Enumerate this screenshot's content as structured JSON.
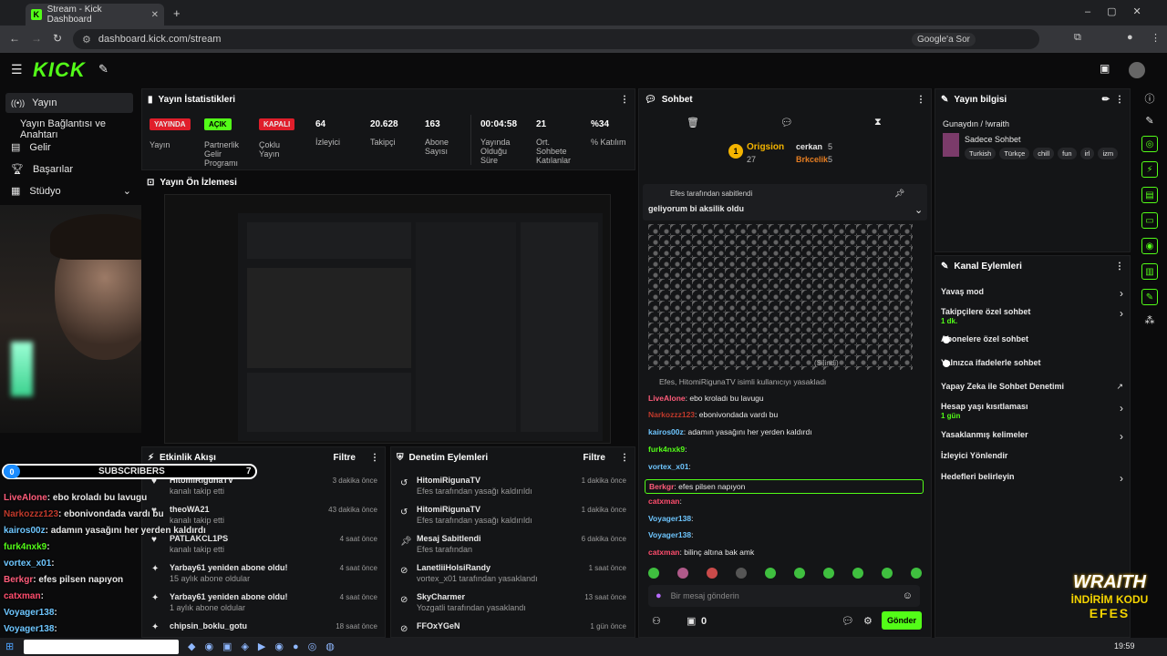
{
  "browser": {
    "tab_title": "Stream - Kick Dashboard",
    "url": "dashboard.kick.com/stream",
    "google_label": "Google'a Sor"
  },
  "nav": {
    "logo": "KICK",
    "items": [
      {
        "label": "Yayın"
      },
      {
        "label": "Yayın Bağlantısı ve Anahtarı"
      },
      {
        "label": "Gelir"
      },
      {
        "label": "Başarılar"
      },
      {
        "label": "Stüdyo"
      }
    ]
  },
  "stats": {
    "title": "Yayın İstatistikleri",
    "status_badges": [
      {
        "label": "YAYINDA",
        "sub": "Yayın"
      },
      {
        "label": "AÇIK",
        "sub": "Partnerlik Gelir Programı"
      },
      {
        "label": "KAPALI",
        "sub": "Çoklu Yayın"
      }
    ],
    "items": [
      {
        "value": "64",
        "label": "İzleyici"
      },
      {
        "value": "20.628",
        "label": "Takipçi"
      },
      {
        "value": "163",
        "label": "Abone Sayısı"
      },
      {
        "value": "00:04:58",
        "label": "Yayında Olduğu Süre"
      },
      {
        "value": "21",
        "label": "Ort. Sohbete Katılanlar"
      },
      {
        "value": "%34",
        "label": "% Katılım"
      }
    ]
  },
  "preview": {
    "title": "Yayın Ön İzlemesi"
  },
  "activity": {
    "title": "Etkinlik Akışı",
    "filter": "Filtre",
    "items": [
      {
        "name": "HitomiRigunaTV",
        "desc": "kanalı takip etti",
        "time": "3 dakika önce"
      },
      {
        "name": "theoWA21",
        "desc": "kanalı takip etti",
        "time": "43 dakika önce"
      },
      {
        "name": "PATLAKCL1PS",
        "desc": "kanalı takip etti",
        "time": "4 saat önce"
      },
      {
        "name": "Yarbay61 yeniden abone oldu!",
        "desc": "15 aylık abone oldular",
        "time": "4 saat önce"
      },
      {
        "name": "Yarbay61 yeniden abone oldu!",
        "desc": "1 aylık abone oldular",
        "time": "4 saat önce"
      },
      {
        "name": "chipsin_boklu_gotu",
        "desc": "",
        "time": "18 saat önce"
      }
    ]
  },
  "moderation": {
    "title": "Denetim Eylemleri",
    "filter": "Filtre",
    "items": [
      {
        "name": "HitomiRigunaTV",
        "desc": "Efes tarafından yasağı kaldırıldı",
        "time": "1 dakika önce"
      },
      {
        "name": "HitomiRigunaTV",
        "desc": "Efes tarafından yasağı kaldırıldı",
        "time": "1 dakika önce"
      },
      {
        "name": "Mesaj Sabitlendi",
        "desc": "Efes tarafından",
        "time": "6 dakika önce"
      },
      {
        "name": "LanetliiHolsiRandy",
        "desc": "vortex_x01 tarafından yasaklandı",
        "time": "1 saat önce"
      },
      {
        "name": "SkyCharmer",
        "desc": "Yozgatli tarafından yasaklandı",
        "time": "13 saat önce"
      },
      {
        "name": "FFOxYGeN",
        "desc": "",
        "time": "1 gün önce"
      }
    ]
  },
  "chat": {
    "title": "Sohbet",
    "top": {
      "first": "Origsion",
      "first_count": "27",
      "second": "cerkan",
      "second_count": "5",
      "third": "Brkcelik",
      "third_count": "5"
    },
    "pinned_by": "Efes tarafından sabitlendi",
    "pinned_text": "geliyorum bi aksilik oldu",
    "deleted": "(Silindi)",
    "ban_notice": "Efes, HitomiRigunaTV isimli kullanıcıyı yasakladı",
    "lines": [
      {
        "user": "LiveAlone",
        "text": ": ebo kroladı bu lavugu",
        "color": "#ff5c7a"
      },
      {
        "user": "Narkozzz123",
        "text": ": ebonivondada vardı bu",
        "color": "#c0392b"
      },
      {
        "user": "kairos00z",
        "text": ": adamın yasağını her yerden kaldırdı",
        "color": "#6ec6ff"
      },
      {
        "user": "furk4nxk9",
        "text": ":",
        "color": "#53fc18"
      },
      {
        "user": "vortex_x01",
        "text": ":",
        "color": "#6ec6ff"
      },
      {
        "user": "Berkgr",
        "text": ": efes pilsen napıyon",
        "color": "#ff5c7a"
      },
      {
        "user": "catxman",
        "text": ":",
        "color": "#ff4d6d"
      },
      {
        "user": "Voyager138",
        "text": ":",
        "color": "#6ec6ff"
      },
      {
        "user": "Voyager138",
        "text": ":",
        "color": "#6ec6ff"
      },
      {
        "user": "catxman",
        "text": ": bilinç altına bak amk",
        "color": "#ff4d6d"
      }
    ],
    "input_placeholder": "Bir mesaj gönderin",
    "count": "0",
    "send": "Gönder"
  },
  "info": {
    "title": "Yayın bilgisi",
    "stream_title": "Gunaydın / !wraith",
    "category": "Sadece Sohbet",
    "tags": [
      "Turkish",
      "Türkçe",
      "chill",
      "fun",
      "irl",
      "izm"
    ]
  },
  "channel_actions": {
    "title": "Kanal Eylemleri",
    "items": [
      {
        "label": "Yavaş mod",
        "sub": "",
        "kind": "arrow"
      },
      {
        "label": "Takipçilere özel sohbet",
        "sub": "1 dk.",
        "kind": "arrow"
      },
      {
        "label": "Abonelere özel sohbet",
        "sub": "",
        "kind": "toggle"
      },
      {
        "label": "Yalnızca ifadelerle sohbet",
        "sub": "",
        "kind": "toggle"
      },
      {
        "label": "Yapay Zeka ile Sohbet Denetimi",
        "sub": "",
        "kind": "ext"
      },
      {
        "label": "Hesap yaşı kısıtlaması",
        "sub": "1 gün",
        "kind": "arrow"
      },
      {
        "label": "Yasaklanmış kelimeler",
        "sub": "",
        "kind": "arrow"
      },
      {
        "label": "İzleyici Yönlendir",
        "sub": "",
        "kind": "none"
      },
      {
        "label": "Hedefleri belirleyin",
        "sub": "",
        "kind": "arrow"
      }
    ]
  },
  "overlay": {
    "sub_count": "0",
    "sub_label": "SUBSCRIBERS",
    "sub_goal": "7",
    "chat": [
      {
        "user": "LiveAlone",
        "text": ": ebo kroladı bu lavugu",
        "color": "#ff5c7a"
      },
      {
        "user": "Narkozzz123",
        "text": ": ebonivondada vardı bu",
        "color": "#c0392b"
      },
      {
        "user": "kairos00z",
        "text": ": adamın yasağını her yerden kaldırdı",
        "color": "#6ec6ff"
      },
      {
        "user": "furk4nxk9",
        "text": ":",
        "color": "#53fc18"
      },
      {
        "user": "vortex_x01",
        "text": ":",
        "color": "#6ec6ff"
      },
      {
        "user": "Berkgr",
        "text": ": efes pilsen napıyon",
        "color": "#ff5c7a"
      },
      {
        "user": "catxman",
        "text": ":",
        "color": "#ff4d6d"
      },
      {
        "user": "Voyager138",
        "text": ":",
        "color": "#6ec6ff"
      },
      {
        "user": "Voyager138",
        "text": ":",
        "color": "#6ec6ff"
      },
      {
        "user": "catxman",
        "text": ": bilinç altına bak amk",
        "color": "#ff4d6d"
      }
    ],
    "promo1": "WRAITH",
    "promo2": "İNDİRİM KODU",
    "promo3": "EFES"
  },
  "taskbar": {
    "time": "19:59"
  }
}
